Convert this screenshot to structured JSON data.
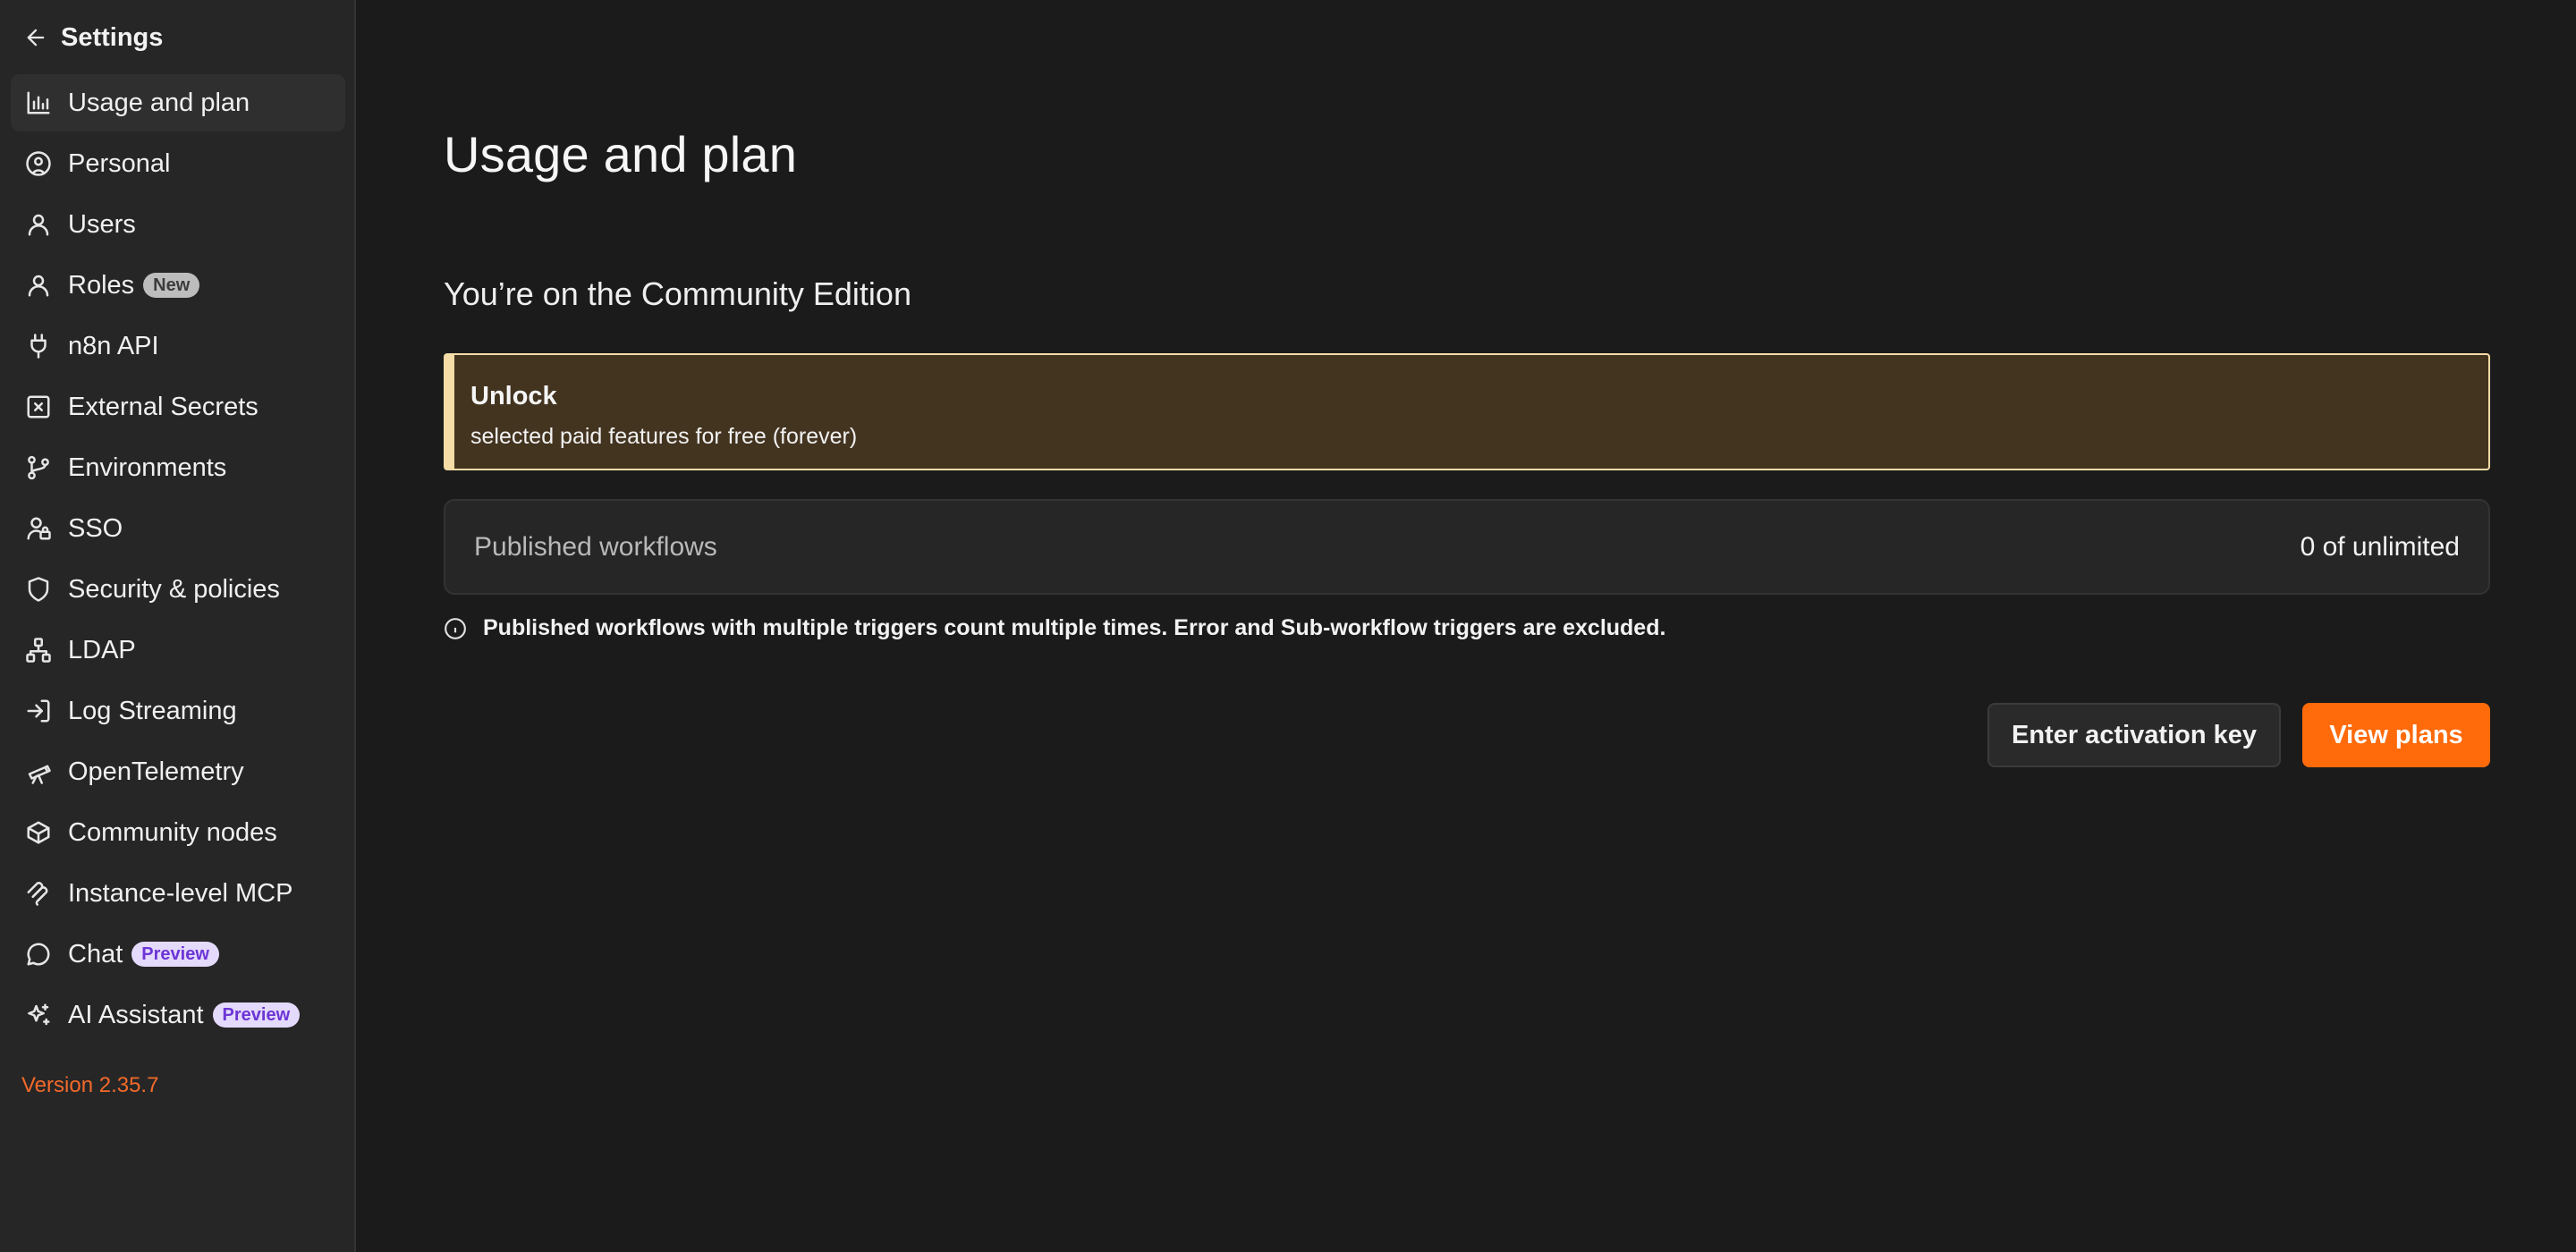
{
  "sidebar": {
    "header": {
      "title": "Settings",
      "back_icon": "arrow-left-icon"
    },
    "items": [
      {
        "label": "Usage and plan",
        "icon": "bar-chart-icon",
        "active": true
      },
      {
        "label": "Personal",
        "icon": "user-circle-icon"
      },
      {
        "label": "Users",
        "icon": "user-icon"
      },
      {
        "label": "Roles",
        "icon": "user-icon",
        "badge": "New"
      },
      {
        "label": "n8n API",
        "icon": "plug-icon"
      },
      {
        "label": "External Secrets",
        "icon": "square-x-icon"
      },
      {
        "label": "Environments",
        "icon": "git-branch-icon"
      },
      {
        "label": "SSO",
        "icon": "user-lock-icon"
      },
      {
        "label": "Security & policies",
        "icon": "shield-icon"
      },
      {
        "label": "LDAP",
        "icon": "network-icon"
      },
      {
        "label": "Log Streaming",
        "icon": "log-in-icon"
      },
      {
        "label": "OpenTelemetry",
        "icon": "telescope-icon"
      },
      {
        "label": "Community nodes",
        "icon": "box-icon"
      },
      {
        "label": "Instance-level MCP",
        "icon": "mcp-icon"
      },
      {
        "label": "Chat",
        "icon": "message-circle-icon",
        "badge": "Preview"
      },
      {
        "label": "AI Assistant",
        "icon": "sparkles-icon",
        "badge": "Preview"
      }
    ],
    "version": "Version 2.35.7"
  },
  "main": {
    "title": "Usage and plan",
    "subtitle": "You’re on the Community Edition",
    "callout": {
      "title": "Unlock",
      "text": "selected paid features for free (forever)"
    },
    "usage": {
      "label": "Published workflows",
      "value": "0 of unlimited"
    },
    "info": "Published workflows with multiple triggers count multiple times. Error and Sub-workflow triggers are excluded.",
    "buttons": {
      "activation": "Enter activation key",
      "plans": "View plans"
    }
  },
  "colors": {
    "accent": "#ff6a0a",
    "version": "#f26a2a",
    "callout_bg": "#433420",
    "callout_border": "#f6dca7",
    "preview_badge_bg": "#e4dafb",
    "preview_badge_text": "#6c35d6"
  }
}
